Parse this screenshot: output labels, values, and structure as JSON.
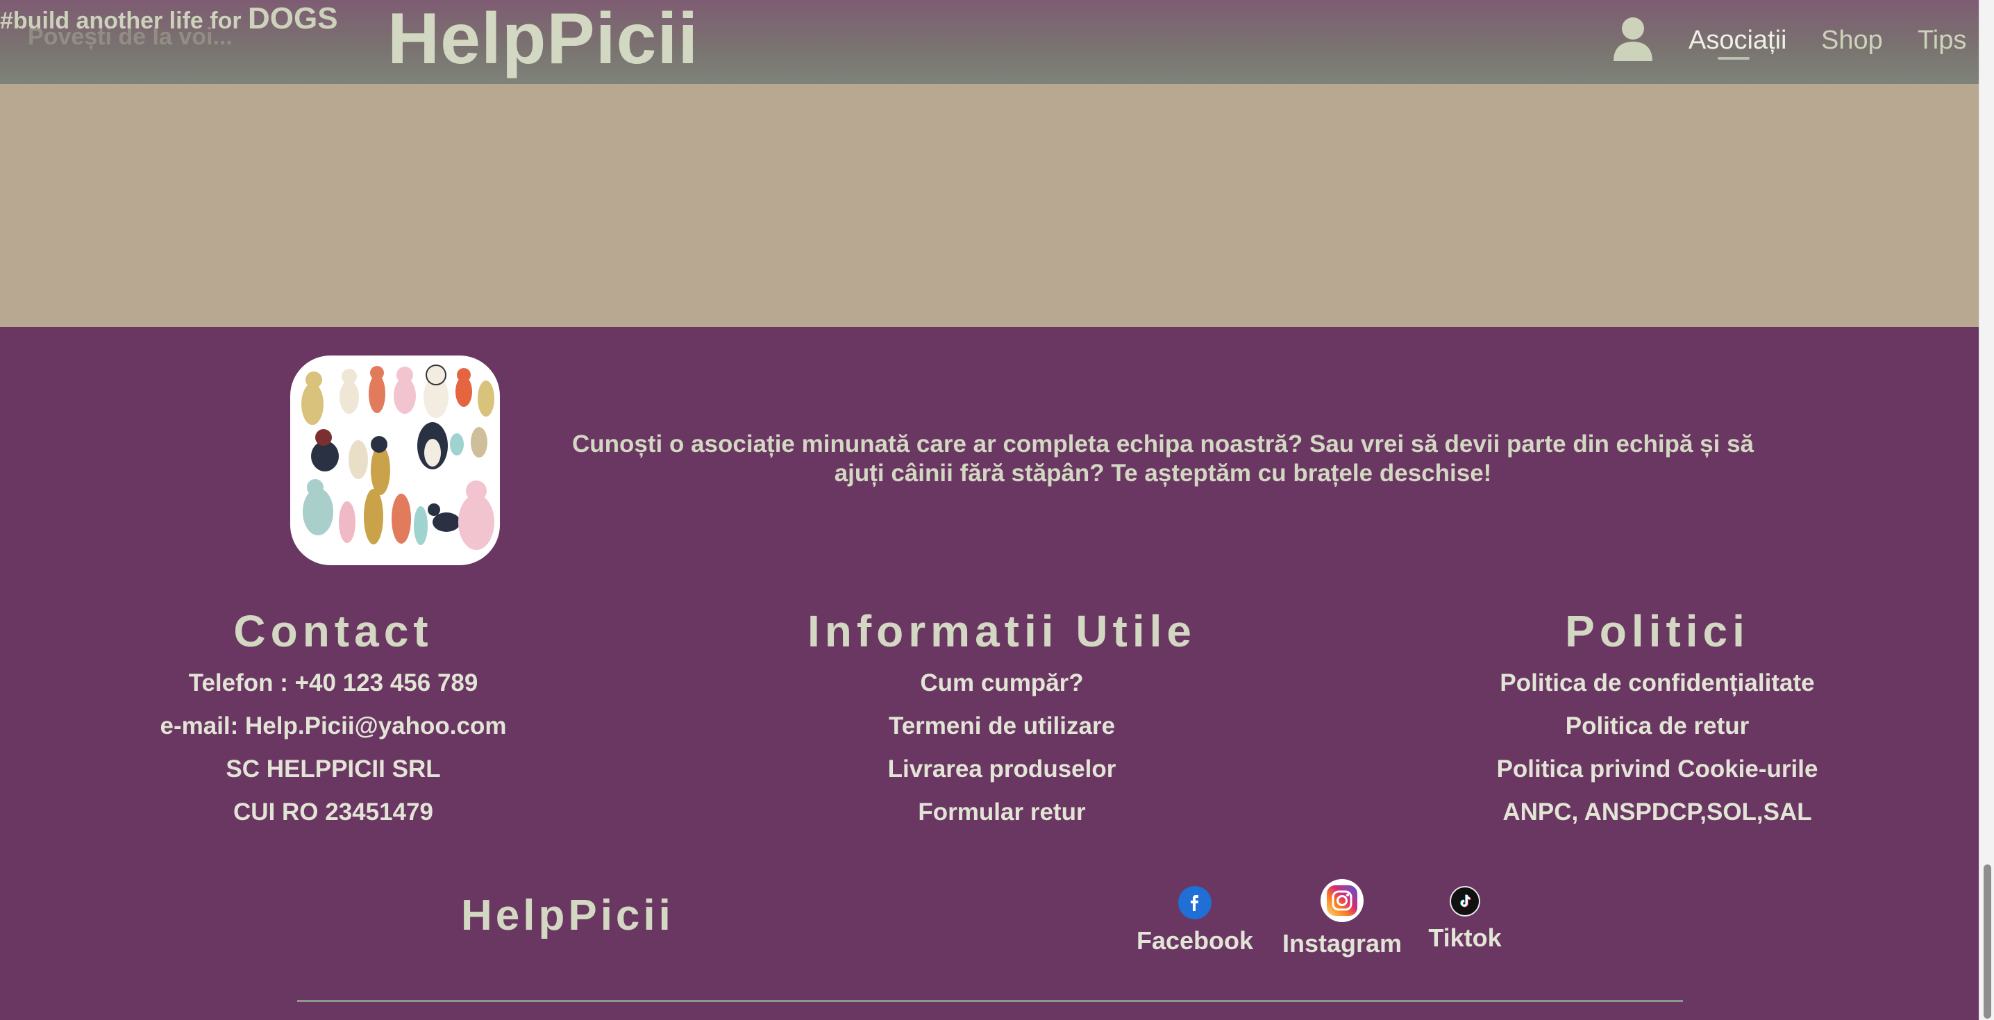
{
  "header": {
    "hashtag_prefix": "#build another life for ",
    "hashtag_emphasis": "DOGS",
    "ghost_text": "Povești de la voi...",
    "brand": "HelpPicii",
    "nav": [
      {
        "label": "Asociații",
        "active": true
      },
      {
        "label": "Shop",
        "active": false
      },
      {
        "label": "Tips",
        "active": false
      }
    ],
    "user_icon": "user-icon"
  },
  "footer": {
    "intro": "Cunoști o asociație minunată care ar completa echipa noastră? Sau vrei să devii parte din echipă și să ajuți câinii fără stăpân? Te așteptăm cu brațele deschise!",
    "contact": {
      "title": "Contact",
      "items": [
        "Telefon : +40 123 456 789",
        "e-mail: Help.Picii@yahoo.com",
        "SC HELPPICII SRL",
        "CUI RO 23451479"
      ]
    },
    "info": {
      "title": "Informatii Utile",
      "items": [
        "Cum cumpăr?",
        "Termeni de utilizare",
        "Livrarea produselor",
        "Formular retur"
      ]
    },
    "policies": {
      "title": "Politici",
      "items": [
        "Politica de confidențialitate",
        "Politica de retur",
        "Politica privind Cookie-urile",
        "ANPC, ANSPDCP,SOL,SAL"
      ]
    },
    "brand": "HelpPicii",
    "social": [
      {
        "label": "Facebook",
        "icon": "facebook-icon",
        "color": "#1f6fd6"
      },
      {
        "label": "Instagram",
        "icon": "instagram-icon",
        "color": "#d62976"
      },
      {
        "label": "Tiktok",
        "icon": "tiktok-icon",
        "color": "#000000"
      }
    ]
  },
  "colors": {
    "header_bg": "#7e5c73",
    "beige": "#b9a891",
    "footer_bg": "#6a3662",
    "text_light": "#d3d8c2"
  }
}
